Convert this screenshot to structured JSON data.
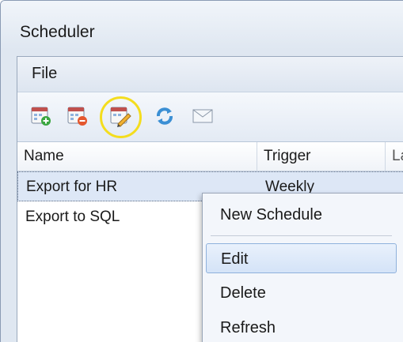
{
  "window": {
    "title": "Scheduler"
  },
  "menu": {
    "file_label": "File"
  },
  "toolbar": {
    "buttons": [
      {
        "icon": "calendar-add-icon"
      },
      {
        "icon": "calendar-remove-icon"
      },
      {
        "icon": "calendar-edit-icon"
      },
      {
        "icon": "refresh-icon"
      },
      {
        "icon": "email-icon"
      }
    ]
  },
  "grid": {
    "columns": [
      "Name",
      "Trigger",
      "La"
    ],
    "rows": [
      {
        "name": "Export for HR",
        "trigger": "Weekly"
      },
      {
        "name": "Export to SQL",
        "trigger": ""
      }
    ]
  },
  "context_menu": {
    "items": [
      "New Schedule",
      "Edit",
      "Delete",
      "Refresh"
    ]
  },
  "colors": {
    "highlight_ring": "#f4dd1e",
    "selection": "#dde7f6"
  }
}
